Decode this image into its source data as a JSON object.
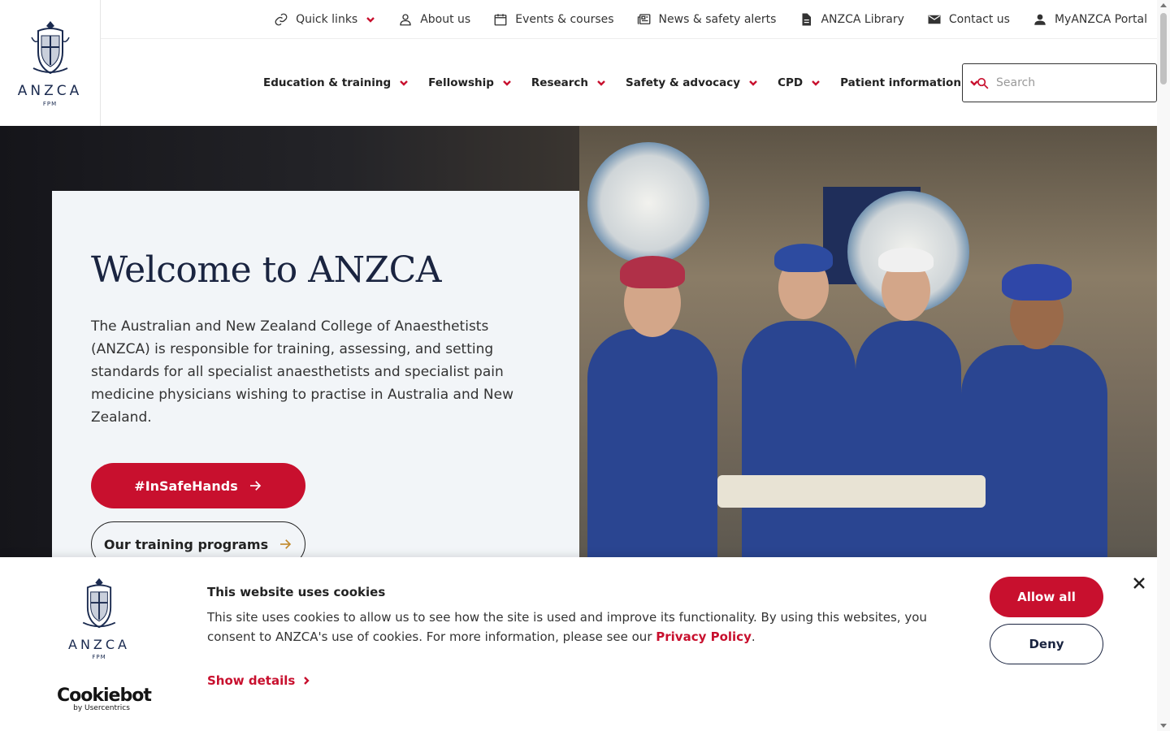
{
  "brand": {
    "logo_text": "ANZCA",
    "logo_sub": "FPM",
    "primary_color": "#c8102e",
    "navy_color": "#1a2440"
  },
  "topbar": {
    "items": [
      {
        "label": "Quick links",
        "icon": "link-icon"
      },
      {
        "label": "About us",
        "icon": "person-icon"
      },
      {
        "label": "Events & courses",
        "icon": "calendar-icon"
      },
      {
        "label": "News & safety alerts",
        "icon": "newspaper-icon"
      },
      {
        "label": "ANZCA Library",
        "icon": "document-icon"
      },
      {
        "label": "Contact us",
        "icon": "mail-icon"
      },
      {
        "label": "MyANZCA Portal",
        "icon": "account-icon"
      }
    ]
  },
  "mainnav": {
    "items": [
      {
        "label": "Education & training"
      },
      {
        "label": "Fellowship"
      },
      {
        "label": "Research"
      },
      {
        "label": "Safety & advocacy"
      },
      {
        "label": "CPD"
      },
      {
        "label": "Patient information"
      }
    ],
    "search_placeholder": "Search"
  },
  "hero": {
    "title": "Welcome to ANZCA",
    "text": "The Australian and New Zealand College of Anaesthetists (ANZCA) is responsible for training, assessing, and setting standards for all specialist anaesthetists and specialist pain medicine physicians wishing to practise in Australia and New Zealand.",
    "primary_button": "#InSafeHands",
    "secondary_button": "Our training programs"
  },
  "cookie_banner": {
    "title": "This website uses cookies",
    "text_before": "This site uses cookies to allow us to see how the site is used and improve its functionality. By using this websites, you consent to ANZCA's use of cookies. For more information, please see our ",
    "link_text": "Privacy Policy",
    "text_after": ".",
    "show_details": "Show details",
    "allow_all": "Allow all",
    "deny": "Deny",
    "logo_text": "ANZCA",
    "logo_sub": "FPM",
    "provider_name": "Cookiebot",
    "provider_by": "by Usercentrics"
  }
}
